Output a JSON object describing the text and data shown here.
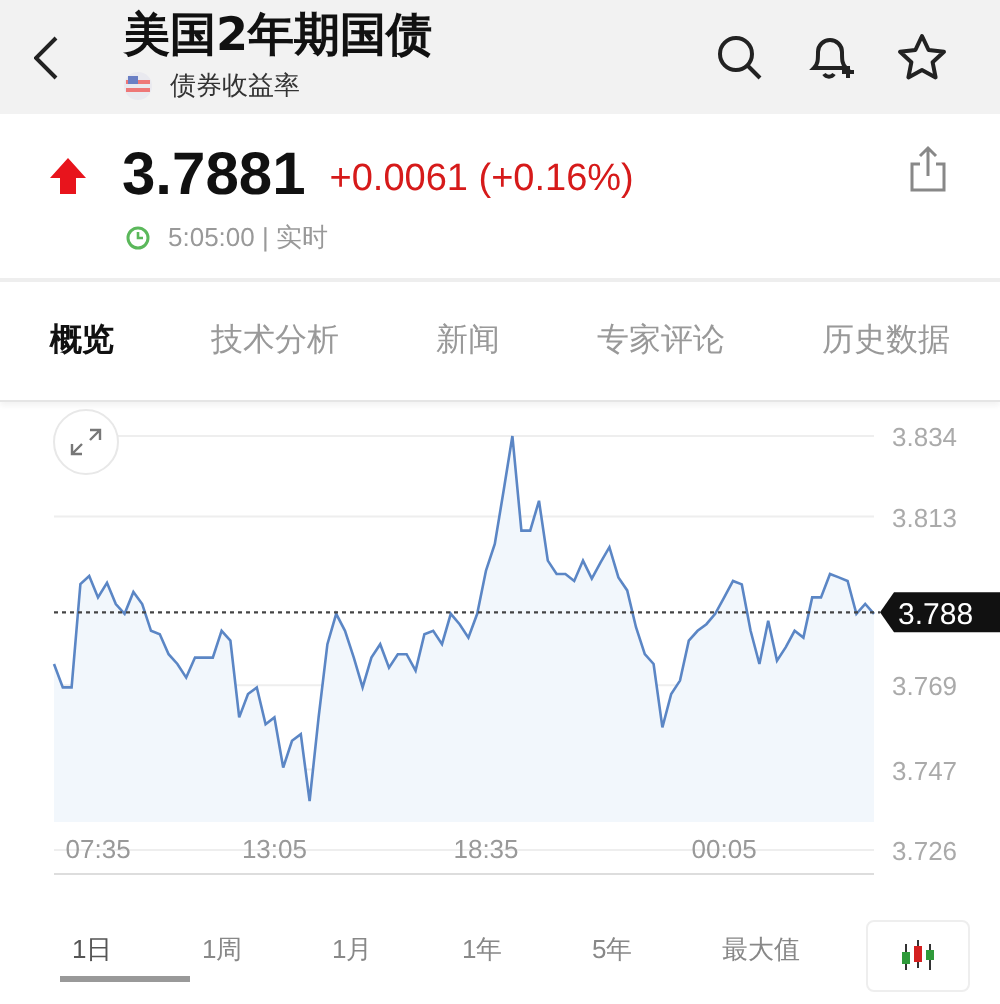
{
  "header": {
    "title": "美国2年期国债",
    "subtitle": "债券收益率"
  },
  "quote": {
    "price": "3.7881",
    "change": "+0.0061 (+0.16%)",
    "time": "5:05:00 | 实时"
  },
  "tabs": [
    {
      "label": "概览",
      "selected": true
    },
    {
      "label": "技术分析",
      "selected": false
    },
    {
      "label": "新闻",
      "selected": false
    },
    {
      "label": "专家评论",
      "selected": false
    },
    {
      "label": "历史数据",
      "selected": false
    }
  ],
  "chart": {
    "chart_data": {
      "type": "area",
      "grid": true,
      "ylim": [
        3.726,
        3.834
      ],
      "categories": [
        null,
        null,
        null,
        null,
        null,
        "07:35",
        null,
        null,
        null,
        null,
        null,
        null,
        null,
        null,
        null,
        null,
        null,
        null,
        null,
        null,
        null,
        null,
        null,
        null,
        null,
        "13:05",
        null,
        null,
        null,
        null,
        null,
        null,
        null,
        null,
        null,
        null,
        null,
        null,
        null,
        null,
        null,
        null,
        null,
        null,
        null,
        null,
        null,
        null,
        null,
        "18:35",
        null,
        null,
        null,
        null,
        null,
        null,
        null,
        null,
        null,
        null,
        null,
        null,
        null,
        null,
        null,
        null,
        null,
        null,
        null,
        null,
        null,
        null,
        null,
        null,
        null,
        null,
        "00:05",
        null,
        null,
        null,
        null,
        null,
        null,
        null,
        null,
        null,
        null,
        null,
        null,
        null,
        null,
        null,
        null,
        null
      ],
      "yticks": [
        {
          "value": 3.834,
          "label": "3.834"
        },
        {
          "value": 3.813,
          "label": "3.813"
        },
        {
          "value": 3.769,
          "label": "3.769"
        },
        {
          "value": 3.747,
          "label": "3.747"
        },
        {
          "value": 3.726,
          "label": "3.726"
        }
      ],
      "series": [
        {
          "color": "#5b86c5",
          "values": [
            3.7745,
            3.7684,
            3.7684,
            3.7954,
            3.7975,
            3.7919,
            3.7957,
            3.7902,
            3.7876,
            3.7933,
            3.7902,
            3.7832,
            3.7823,
            3.7771,
            3.7745,
            3.771,
            3.7762,
            3.7762,
            3.7762,
            3.7832,
            3.7806,
            3.7606,
            3.7667,
            3.7684,
            3.7588,
            3.7606,
            3.7475,
            3.7545,
            3.7562,
            3.7388,
            3.7606,
            3.7797,
            3.7876,
            3.7832,
            3.7762,
            3.7684,
            3.7762,
            3.7797,
            3.7736,
            3.7771,
            3.7771,
            3.7728,
            3.7823,
            3.7832,
            3.7797,
            3.7876,
            3.7849,
            3.7814,
            3.7876,
            3.7989,
            3.8058,
            3.8197,
            3.834,
            3.8093,
            3.8093,
            3.8171,
            3.8015,
            3.798,
            3.798,
            3.7962,
            3.8015,
            3.7968,
            3.801,
            3.805,
            3.7971,
            3.7937,
            3.7841,
            3.7771,
            3.7745,
            3.758,
            3.7667,
            3.7702,
            3.7806,
            3.7832,
            3.7849,
            3.7876,
            3.7919,
            3.7962,
            3.7953,
            3.7832,
            3.7745,
            3.7858,
            3.7754,
            3.7789,
            3.7832,
            3.7814,
            3.7919,
            3.7919,
            3.798,
            3.7971,
            3.7962,
            3.7876,
            3.7902,
            3.7876
          ]
        }
      ],
      "ref_lines": [
        {
          "axis": "y",
          "value": 3.788,
          "label": "3.788"
        }
      ]
    }
  },
  "periods": [
    {
      "label": "1日",
      "selected": true
    },
    {
      "label": "1周",
      "selected": false
    },
    {
      "label": "1月",
      "selected": false
    },
    {
      "label": "1年",
      "selected": false
    },
    {
      "label": "5年",
      "selected": false
    },
    {
      "label": "最大值",
      "selected": false
    }
  ]
}
